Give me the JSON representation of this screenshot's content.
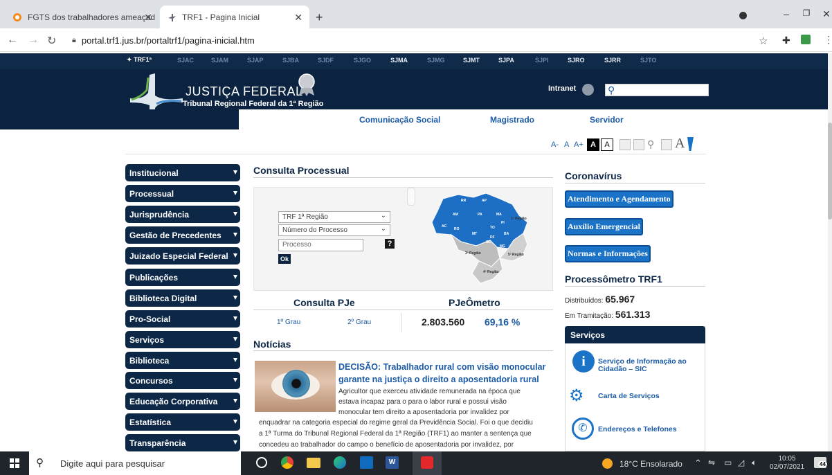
{
  "browser": {
    "tabs": [
      {
        "title": "FGTS dos trabalhadores ameaçad",
        "active": false
      },
      {
        "title": "TRF1 - Pagina Inicial",
        "active": true
      }
    ],
    "url": "portal.trf1.jus.br/portaltrf1/pagina-inicial.htm"
  },
  "sj_bar": {
    "brand": "TRF1ª",
    "items": [
      "SJAC",
      "SJAM",
      "SJAP",
      "SJBA",
      "SJDF",
      "SJGO",
      "SJMA",
      "SJMG",
      "SJMT",
      "SJPA",
      "SJPI",
      "SJRO",
      "SJRR",
      "SJTO"
    ]
  },
  "header": {
    "title": "JUSTIÇA FEDERAL",
    "subtitle": "Tribunal Regional Federal da 1ª Região",
    "intranet": "Intranet",
    "nav": [
      "Comunicação Social",
      "Magistrado",
      "Servidor"
    ]
  },
  "a11y": {
    "a_minus": "A-",
    "a": "A",
    "a_plus": "A+",
    "contrast1": "A",
    "contrast2": "A"
  },
  "sidebar": {
    "items": [
      "Institucional",
      "Processual",
      "Jurisprudência",
      "Gestão de Precedentes",
      "Juizado Especial Federal",
      "Publicações",
      "Biblioteca Digital",
      "Pro-Social",
      "Serviços",
      "Biblioteca",
      "Concursos",
      "Educação Corporativa",
      "Estatística",
      "Transparência"
    ]
  },
  "consulta": {
    "title": "Consulta Processual",
    "select1": "TRF 1ª Região",
    "select2": "Número do Processo",
    "input_placeholder": "Processo",
    "help": "?",
    "ok": "Ok",
    "map_labels": [
      "1ª Região",
      "3ª Região",
      "4ª Região",
      "5ª Região"
    ],
    "states": [
      "AM",
      "PA",
      "MA",
      "AC",
      "RO",
      "MT",
      "TO",
      "GO",
      "BA",
      "PI",
      "DF",
      "MG",
      "RR",
      "AP"
    ]
  },
  "pje": {
    "title": "Consulta PJe",
    "grau1": "1º Grau",
    "grau2": "2º Grau",
    "metro_title": "PJeÔmetro",
    "count": "2.803.560",
    "pct": "69,16 %"
  },
  "news": {
    "title": "Notícias",
    "headline": "DECISÃO: Trabalhador rural com visão monocular garante na justiça o direito a aposentadoria rural",
    "lines": [
      "Agricultor que exerceu atividade remunerada na época que",
      "estava incapaz para o para o labor rural e possui visão",
      "monocular tem direito a aposentadoria por invalidez por",
      "enquadrar na categoria especial do regime geral da Previdência Social. Foi o que decidiu",
      "a 1ª Turma do Tribunal Regional Federal da 1ª Região (TRF1) ao manter a sentença que",
      "concedeu ao trabalhador do campo o benefício de aposentadoria por invalidez, por"
    ]
  },
  "right": {
    "corona_title": "Coronavírus",
    "buttons": [
      "Atendimento e Agendamento",
      "Auxílio Emergencial",
      "Normas e Informações"
    ],
    "proc_title": "Processômetro TRF1",
    "dist_label": "Distribuídos:",
    "dist_value": "65.967",
    "tram_label": "Em Tramitação:",
    "tram_value": "561.313",
    "services_title": "Serviços",
    "services": [
      "Serviço de Informação ao Cidadão – SIC",
      "Carta de Serviços",
      "Endereços e Telefones"
    ]
  },
  "taskbar": {
    "search": "Digite aqui para pesquisar",
    "weather": "18°C  Ensolarado",
    "time": "10:05",
    "date": "02/07/2021",
    "badge": "44"
  }
}
